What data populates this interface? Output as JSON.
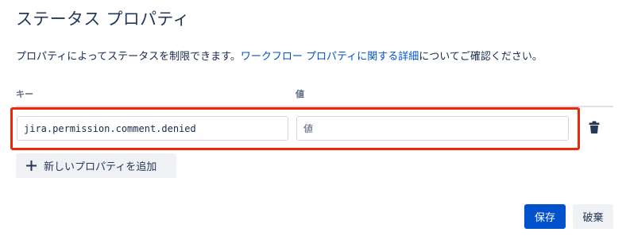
{
  "dialog": {
    "title": "ステータス プロパティ",
    "description_before": "プロパティによってステータスを制限できます。",
    "description_link": "ワークフロー プロパティに関する詳細",
    "description_after": "についてご確認ください。"
  },
  "table": {
    "header_key": "キー",
    "header_value": "値",
    "rows": [
      {
        "key": "jira.permission.comment.denied",
        "value_placeholder": "値"
      }
    ]
  },
  "actions": {
    "add_property_label": "新しいプロパティを追加",
    "save_label": "保存",
    "cancel_label": "破棄"
  },
  "icons": {
    "delete_row": "trash-icon",
    "add": "plus-icon"
  },
  "colors": {
    "primary": "#0052cc",
    "highlight_border": "#f0260b",
    "link": "#0052cc"
  }
}
